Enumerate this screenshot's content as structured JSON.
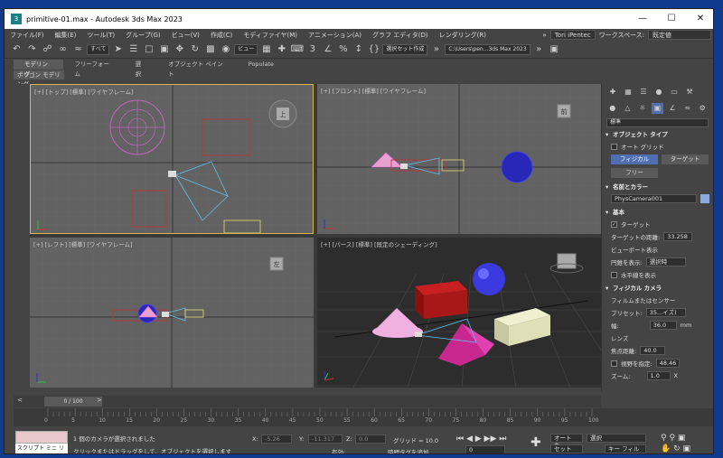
{
  "window": {
    "title": "primitive-01.max - Autodesk 3ds Max 2023",
    "icon_letter": "3"
  },
  "menu": [
    "ファイル(F)",
    "編集(E)",
    "ツール(T)",
    "グループ(G)",
    "ビュー(V)",
    "作成(C)",
    "モディファイヤ(M)",
    "アニメーション(A)",
    "グラフ エディタ(D)",
    "レンダリング(R)"
  ],
  "user": {
    "name": "Tori iPentec",
    "workspace_label": "ワークスペース:",
    "workspace_value": "既定値"
  },
  "toolbar": {
    "filter_select": "すべて",
    "view_select": "ビュー",
    "selection_set": "選択セット作成",
    "path": "C:\\Users\\pen...3ds Max 2023"
  },
  "ribbon": {
    "tabs": [
      "モデリング",
      "フリーフォーム",
      "選択",
      "オブジェクト ペイント",
      "Populate"
    ],
    "sub": "ポリゴン モデリング"
  },
  "viewports": {
    "top": "[+] [トップ] [標準] [ワイヤフレーム]",
    "front": "[+] [フロント] [標準] [ワイヤフレーム]",
    "left": "[+] [レフト] [標準] [ワイヤフレーム]",
    "persp": "[+] [パース] [標準] [既定のシェーディング]",
    "cube_top": "上",
    "cube_front": "前",
    "cube_left": "左"
  },
  "panel": {
    "category": "標準",
    "object_type_title": "オブジェクト タイプ",
    "auto_grid": "オート グリッド",
    "btn_physical": "フィジカル",
    "btn_target": "ターゲット",
    "btn_free": "フリー",
    "name_color_title": "名前とカラー",
    "object_name": "PhysCamera001",
    "basic_title": "基本",
    "target_label": "ターゲット",
    "target_distance_label": "ターゲットの距離:",
    "target_distance_value": "33.258",
    "viewport_display": "ビューポート表示",
    "show_cone_label": "円錐を表示:",
    "show_cone_value": "選択時",
    "show_horizon": "水平線を表示",
    "physical_camera_title": "フィジカル カメラ",
    "film_sensor": "フィルムまたはセンサー",
    "preset_label": "プリセット:",
    "preset_value": "35...イズ)",
    "width_label": "幅:",
    "width_value": "36.0",
    "width_unit": "mm",
    "lens_label": "レンズ",
    "focal_label": "焦点距離:",
    "focal_value": "40.0",
    "fov_label": "視野を指定:",
    "fov_value": "48.46",
    "zoom_label": "ズーム:",
    "zoom_value": "1.0",
    "zoom_unit": "X"
  },
  "timeline": {
    "frame": "0 / 100",
    "ticks": [
      "0",
      "5",
      "10",
      "15",
      "20",
      "25",
      "30",
      "35",
      "40",
      "45",
      "50",
      "55",
      "60",
      "65",
      "70",
      "75",
      "80",
      "85",
      "90",
      "95",
      "100"
    ]
  },
  "status": {
    "maxscript": "スクリプト ミニ リス",
    "line1": "1 個のカメラが選択されました",
    "line2": "クリックまたはドラッグをして、オブジェクトを選択します",
    "x_label": "X:",
    "x_value": "-5.26",
    "y_label": "Y:",
    "y_value": "-11.317",
    "z_label": "Z:",
    "z_value": "0.0",
    "grid": "グリッド = 10.0",
    "enabled": "有効:",
    "add_time_tag": "時間タグを追加",
    "auto_key": "オート キー",
    "set_key": "セット キー",
    "selection_select": "選択",
    "key_filter": "キー フィルタ...",
    "frame_value": "0"
  }
}
